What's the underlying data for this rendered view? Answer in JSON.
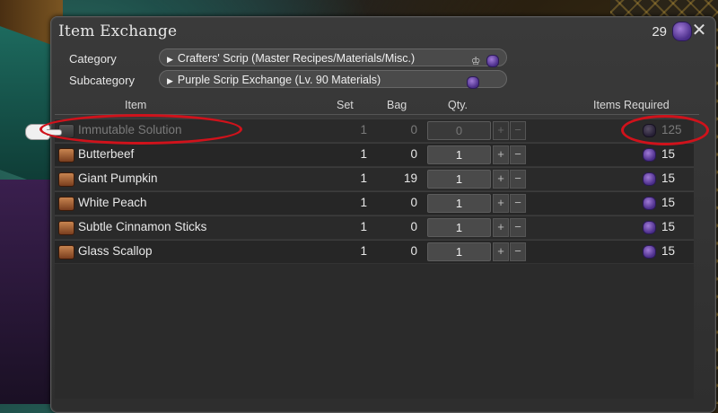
{
  "window": {
    "title": "Item Exchange",
    "currency_count": "29"
  },
  "filters": {
    "category_label": "Category",
    "category_value": "Crafters' Scrip (Master Recipes/Materials/Misc.)",
    "subcategory_label": "Subcategory",
    "subcategory_value": "Purple Scrip Exchange (Lv. 90 Materials)"
  },
  "columns": {
    "item": "Item",
    "set": "Set",
    "bag": "Bag",
    "qty": "Qty.",
    "required": "Items Required"
  },
  "rows": [
    {
      "name": "Immutable Solution",
      "set": "1",
      "bag": "0",
      "qty": "0",
      "required": "125",
      "disabled": true
    },
    {
      "name": "Butterbeef",
      "set": "1",
      "bag": "0",
      "qty": "1",
      "required": "15"
    },
    {
      "name": "Giant Pumpkin",
      "set": "1",
      "bag": "19",
      "qty": "1",
      "required": "15"
    },
    {
      "name": "White Peach",
      "set": "1",
      "bag": "0",
      "qty": "1",
      "required": "15"
    },
    {
      "name": "Subtle Cinnamon Sticks",
      "set": "1",
      "bag": "0",
      "qty": "1",
      "required": "15"
    },
    {
      "name": "Glass Scallop",
      "set": "1",
      "bag": "0",
      "qty": "1",
      "required": "15"
    }
  ],
  "buttons": {
    "plus": "+",
    "minus": "−",
    "close": "✕",
    "dropdown_arrow": "▶"
  },
  "icons": {
    "currency": "purple-scrip-icon",
    "crafter": "crafter-icon",
    "annotation_color": "#d0121b"
  }
}
